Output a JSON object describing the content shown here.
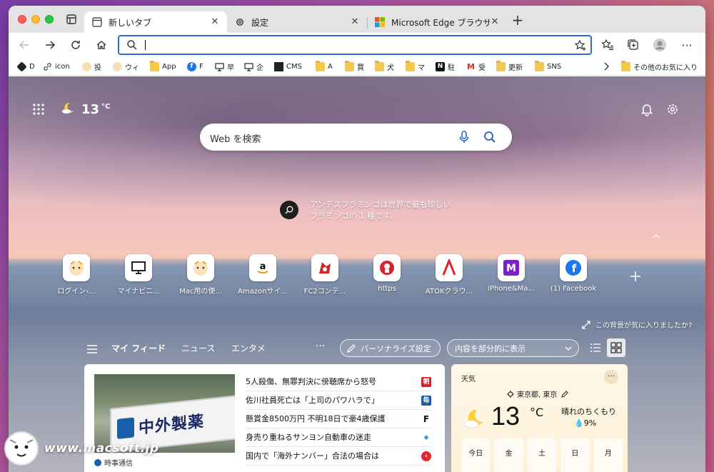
{
  "browser": {
    "tabs": [
      {
        "label": "新しいタブ",
        "icon": "new-tab-page-icon",
        "active": true
      },
      {
        "label": "設定",
        "icon": "gear-icon",
        "active": false
      },
      {
        "label": "Microsoft Edge ブラウザーの主",
        "icon": "microsoft-logo-icon",
        "active": false
      }
    ],
    "address_value": "",
    "accent": "#2a6fd6"
  },
  "bookmarks": [
    {
      "label": "D",
      "icon": "bookmark-dark-icon"
    },
    {
      "label": "icon",
      "icon": "link-icon"
    },
    {
      "label": "投",
      "icon": "mascot-icon"
    },
    {
      "label": "ウィ",
      "icon": "mascot-icon"
    },
    {
      "label": "App",
      "icon": "folder-icon"
    },
    {
      "label": "F",
      "icon": "facebook-icon"
    },
    {
      "label": "早",
      "icon": "monitor-icon"
    },
    {
      "label": "企",
      "icon": "monitor-icon"
    },
    {
      "label": "CMS",
      "icon": "cms-icon"
    },
    {
      "label": "A",
      "icon": "folder-icon"
    },
    {
      "label": "買",
      "icon": "folder-icon"
    },
    {
      "label": "犬",
      "icon": "folder-icon"
    },
    {
      "label": "マ",
      "icon": "folder-icon"
    },
    {
      "label": "駐",
      "icon": "notion-icon"
    },
    {
      "label": "受",
      "icon": "gmail-icon"
    },
    {
      "label": "更新",
      "icon": "folder-icon"
    },
    {
      "label": "SNS",
      "icon": "folder-icon"
    }
  ],
  "bookmarks_other": "その他のお気に入り",
  "newtab": {
    "weather_temp": "13",
    "weather_unit": "°C",
    "search_placeholder": "Web を検索",
    "image_info_line1": "アンデスフラミンゴは世界で最も珍しい",
    "image_info_line2": "フラミンゴの 1 種です。",
    "bg_feedback": "この背景が気に入りましたか?",
    "tiles": [
      {
        "label": "ログイン‹..."
      },
      {
        "label": "マイナビニ..."
      },
      {
        "label": "Mac用の便..."
      },
      {
        "label": "Amazonサイ..."
      },
      {
        "label": "FC2コンテ..."
      },
      {
        "label": "https"
      },
      {
        "label": "ATOKクラウ..."
      },
      {
        "label": "iPhone&Ma..."
      },
      {
        "label": "(1) Facebook"
      }
    ],
    "feed_tabs": [
      "マイ フィード",
      "ニュース",
      "エンタメ"
    ],
    "personalize_label": "パーソナライズ設定",
    "content_select_value": "内容を部分的に表示"
  },
  "news": {
    "image_sign_text": "中外製薬",
    "source": "時事通信",
    "headlines": [
      {
        "text": "5人殺傷、無罪判決に傍聴席から怒号",
        "badge": "朝",
        "color": "#d0202a"
      },
      {
        "text": "佐川社員死亡は「上司のパワハラで」",
        "badge": "毎",
        "color": "#1a5aa6"
      },
      {
        "text": "懸賞金8500万円 不明18日で豪4歳保護",
        "badge": "F",
        "color": "#111111"
      },
      {
        "text": "身売り重ねるサンヨン自動車の迷走",
        "badge": "◆",
        "color": "#3a9ad9"
      },
      {
        "text": "国内で「海外ナンバー」合法の場合は",
        "badge": "‹",
        "color": "#e0282f"
      }
    ]
  },
  "weather_card": {
    "title": "天気",
    "location": "東京都, 東京",
    "temp": "13",
    "unit": "°C",
    "condition": "晴れのちくもり",
    "precip": "9%",
    "days": [
      "今日",
      "金",
      "土",
      "日",
      "月"
    ]
  },
  "watermark": "www.macsoft.jp"
}
